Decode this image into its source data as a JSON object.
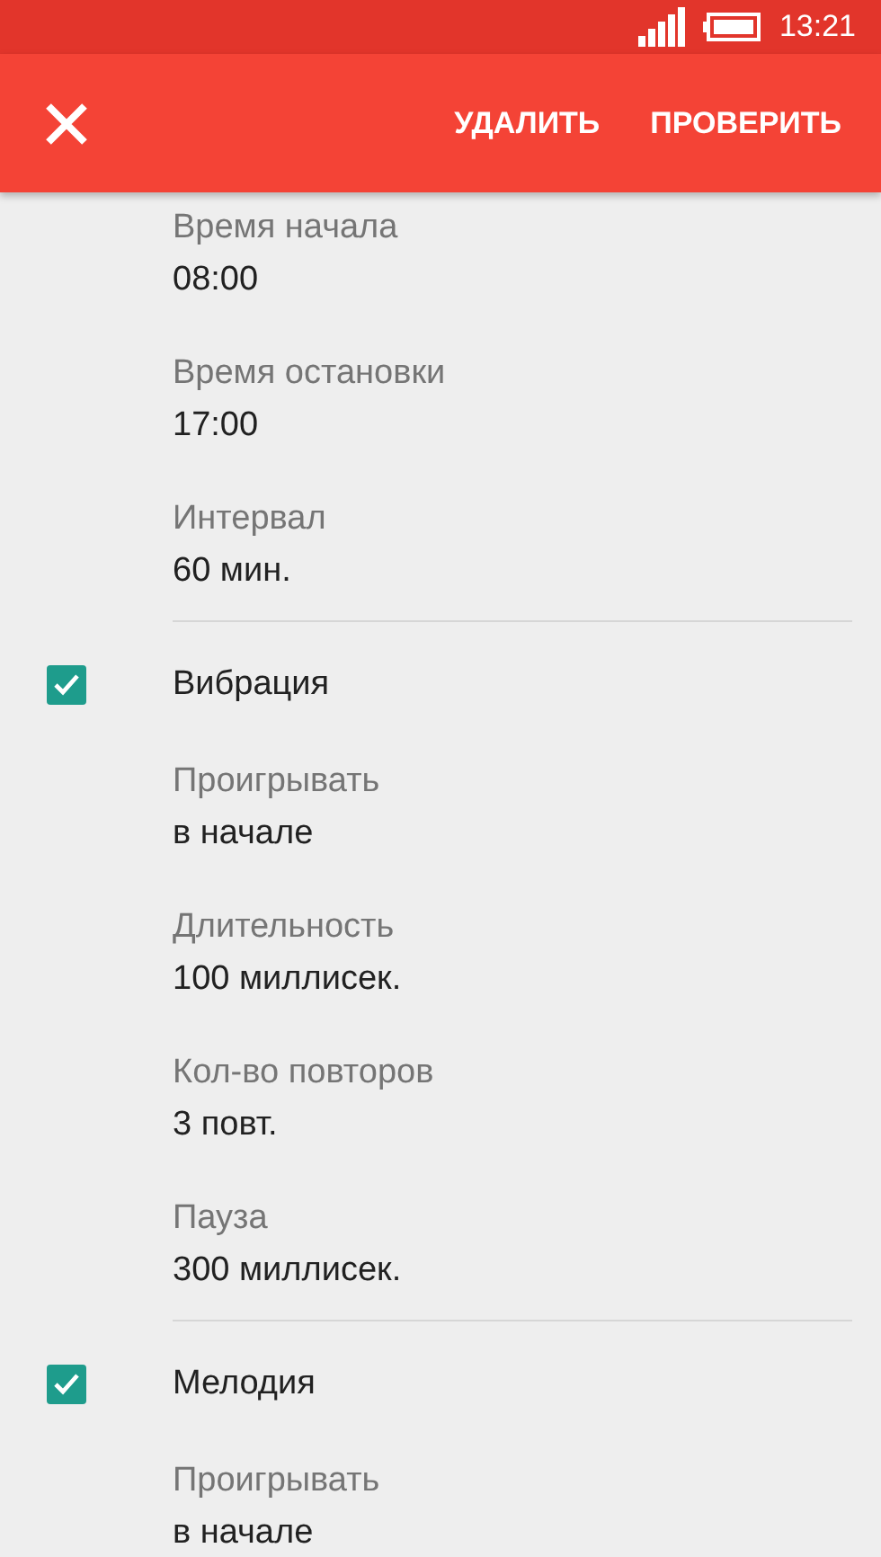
{
  "status_bar": {
    "time": "13:21"
  },
  "toolbar": {
    "actions": [
      "УДАЛИТЬ",
      "ПРОВЕРИТЬ"
    ]
  },
  "settings": [
    {
      "kind": "field",
      "title": "Время начала",
      "value": "08:00"
    },
    {
      "kind": "field",
      "title": "Время остановки",
      "value": "17:00"
    },
    {
      "kind": "field",
      "title": "Интервал",
      "value": "60 мин."
    },
    {
      "kind": "checkbox",
      "title": "Вибрация",
      "checked": true
    },
    {
      "kind": "field",
      "title": "Проигрывать",
      "value": "в начале"
    },
    {
      "kind": "field",
      "title": "Длительность",
      "value": "100 миллисек."
    },
    {
      "kind": "field",
      "title": "Кол-во повторов",
      "value": "3 повт."
    },
    {
      "kind": "field",
      "title": "Пауза",
      "value": "300 миллисек."
    },
    {
      "kind": "checkbox",
      "title": "Мелодия",
      "checked": true
    },
    {
      "kind": "field",
      "title": "Проигрывать",
      "value": "в начале"
    }
  ]
}
